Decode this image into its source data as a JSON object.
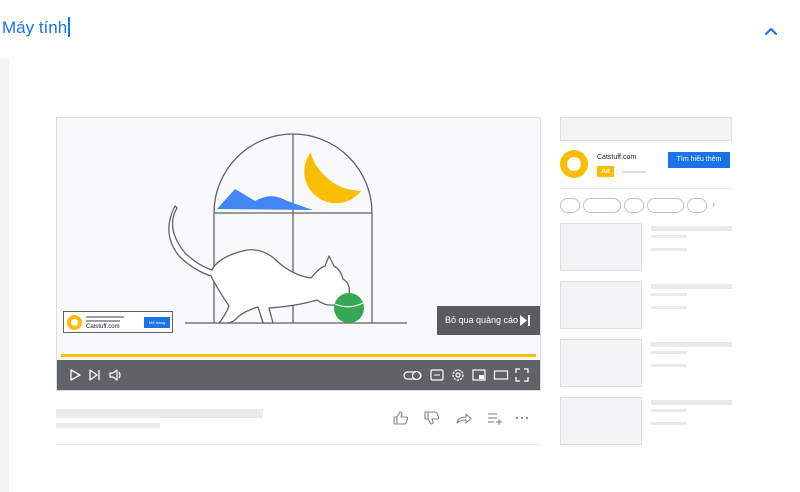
{
  "section": {
    "title": "Máy tính",
    "collapse_icon": "chevron-up-icon",
    "accent": "#1a73e8"
  },
  "player": {
    "ad_card": {
      "domain": "Catstuff.com",
      "cta": "Mở trang"
    },
    "skip_label": "Bỏ qua quảng cáo",
    "progress": 1.0,
    "progress_color": "#fbbc04",
    "controls": [
      "play-icon",
      "next-icon",
      "volume-icon",
      "autoplay-toggle-icon",
      "captions-icon",
      "settings-icon",
      "miniplayer-icon",
      "theater-mode-icon",
      "fullscreen-icon"
    ]
  },
  "actions": [
    "like-icon",
    "dislike-icon",
    "share-icon",
    "save-to-playlist-icon",
    "more-icon"
  ],
  "sidebar": {
    "ad": {
      "advertiser": "Catstuff.com",
      "badge": "Ad",
      "cta": "Tìm hiểu thêm",
      "brand_color": "#fbbc04"
    },
    "chip_count": 5,
    "recommendation_count": 4
  }
}
